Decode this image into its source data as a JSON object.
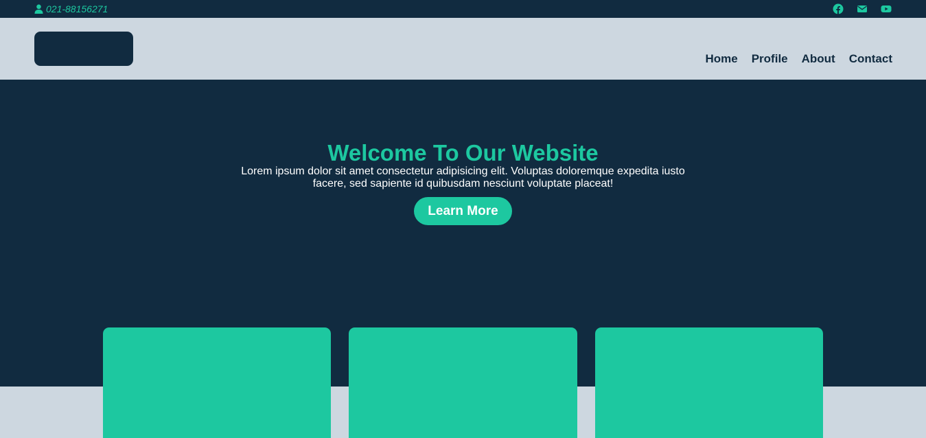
{
  "topbar": {
    "phone": "021-88156271",
    "phone_icon": "user-icon",
    "socials": [
      "facebook-icon",
      "mail-icon",
      "youtube-icon"
    ]
  },
  "header": {
    "nav": [
      "Home",
      "Profile",
      "About",
      "Contact"
    ]
  },
  "hero": {
    "title": "Welcome To Our Website",
    "text": "Lorem ipsum dolor sit amet consectetur adipisicing elit. Voluptas doloremque expedita iusto facere, sed sapiente id quibusdam nesciunt voluptate placeat!",
    "button": "Learn More"
  },
  "colors": {
    "dark": "#112b40",
    "accent": "#1dc8a0",
    "light": "#cdd7e0"
  }
}
